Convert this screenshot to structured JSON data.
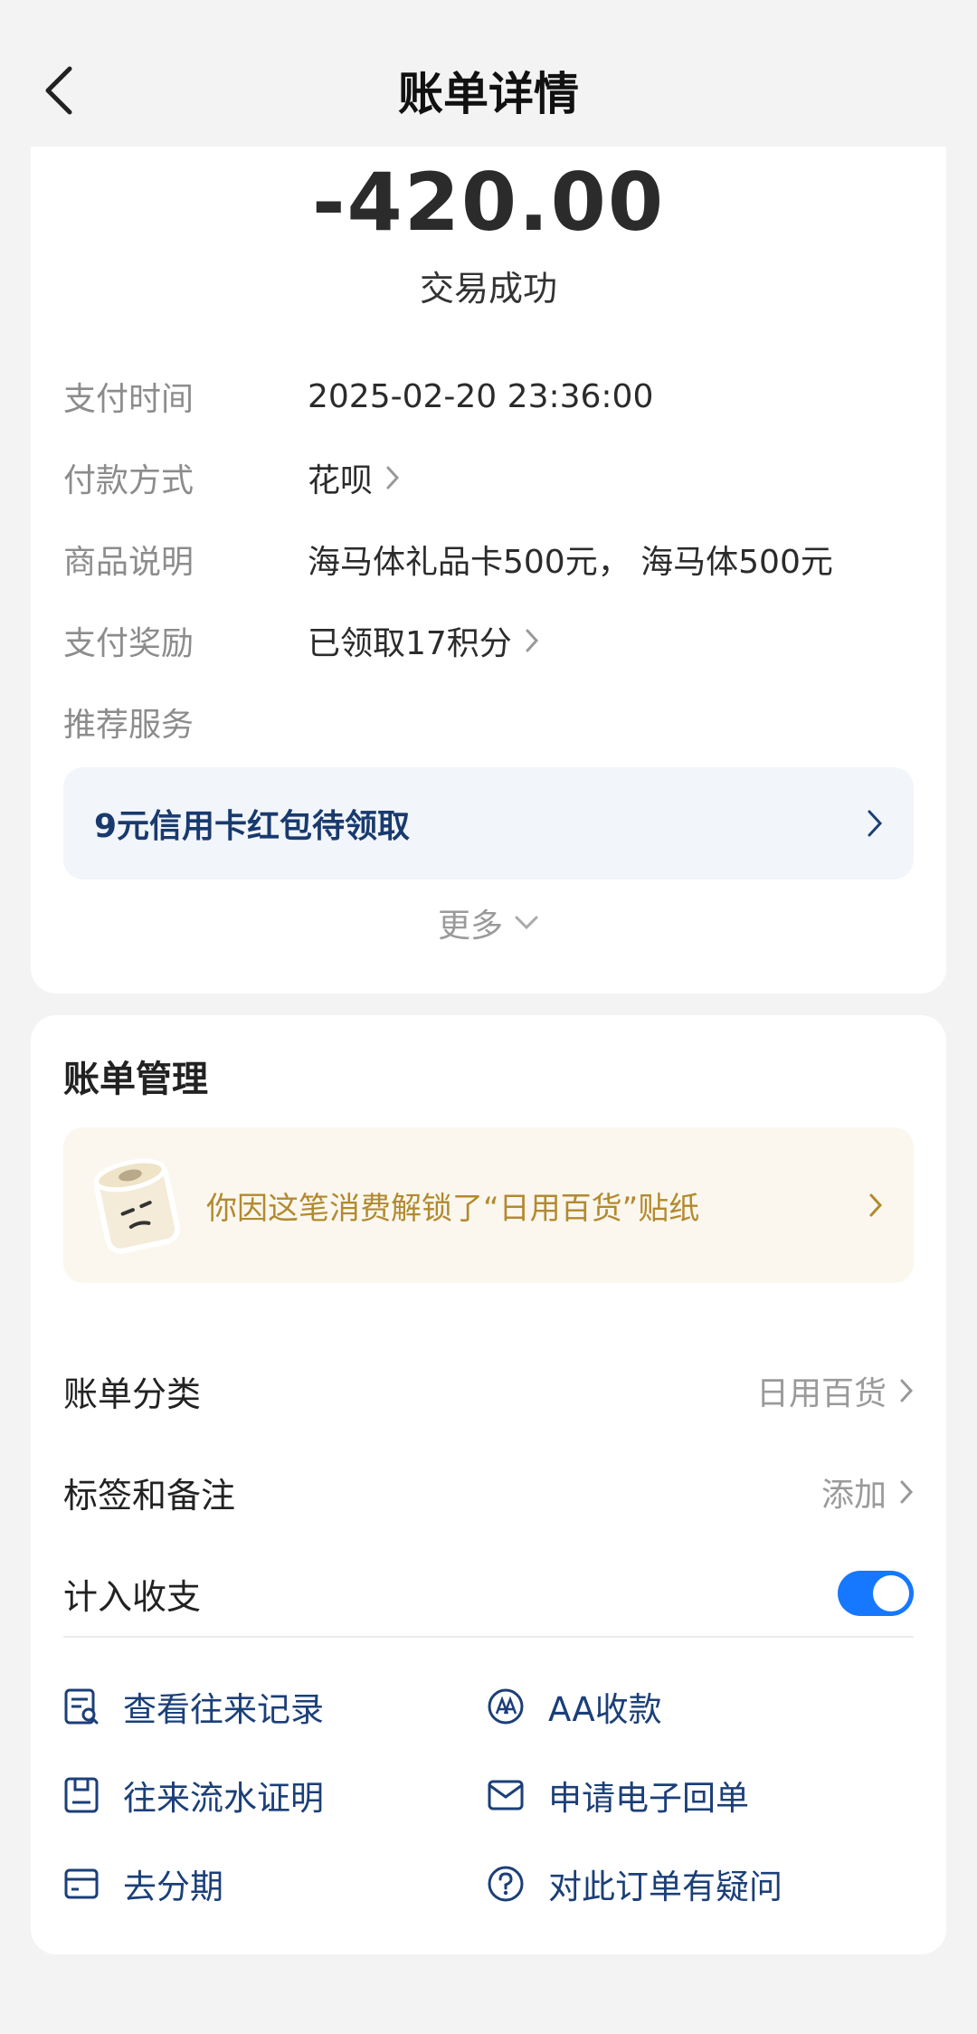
{
  "header": {
    "title": "账单详情"
  },
  "summary": {
    "amount": "-420.00",
    "status": "交易成功"
  },
  "details": [
    {
      "label": "支付时间",
      "value": "2025-02-20 23:36:00"
    },
    {
      "label": "付款方式",
      "value": "花呗"
    },
    {
      "label": "商品说明",
      "value": "海马体礼品卡500元， 海马体500元"
    },
    {
      "label": "支付奖励",
      "value": "已领取17积分"
    },
    {
      "label": "推荐服务",
      "value": ""
    }
  ],
  "promo": {
    "text": "9元信用卡红包待领取"
  },
  "more": {
    "label": "更多"
  },
  "management": {
    "title": "账单管理",
    "sticker_text": "你因这笔消费解锁了“日用百货”贴纸",
    "category_label": "账单分类",
    "category_value": "日用百货",
    "tags_label": "标签和备注",
    "tags_value": "添加",
    "include_label": "计入收支",
    "include_on": true
  },
  "actions": [
    {
      "label": "查看往来记录",
      "icon": "record-search-icon"
    },
    {
      "label": "AA收款",
      "icon": "aa-icon"
    },
    {
      "label": "往来流水证明",
      "icon": "document-icon"
    },
    {
      "label": "申请电子回单",
      "icon": "mail-icon"
    },
    {
      "label": "去分期",
      "icon": "card-icon"
    },
    {
      "label": "对此订单有疑问",
      "icon": "question-icon"
    }
  ],
  "colors": {
    "accent": "#1677ff",
    "link": "#1b3f78",
    "sticker_text": "#b28a2e"
  }
}
